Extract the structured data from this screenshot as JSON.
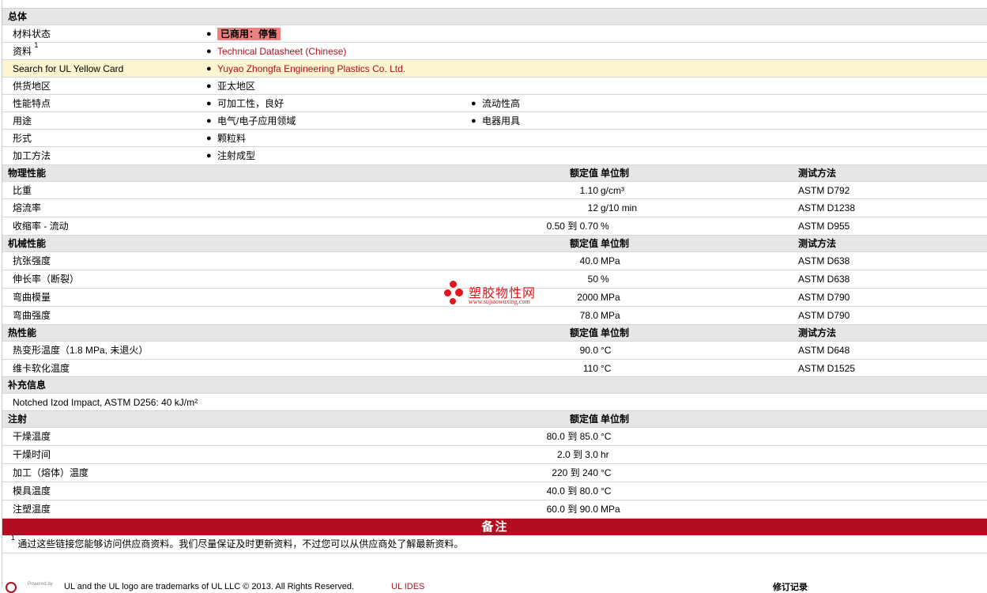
{
  "sections": {
    "general": {
      "title": "总体",
      "material_status_label": "材料状态",
      "material_status_value": "已商用：停售",
      "docs_label": "资料",
      "docs_sup": "1",
      "docs_link": "Technical Datasheet (Chinese)",
      "ul_label": "Search for UL Yellow Card",
      "ul_link": "Yuyao Zhongfa Engineering Plastics Co. Ltd.",
      "region_label": "供货地区",
      "region_value": "亚太地区",
      "features_label": "性能特点",
      "features": [
        "可加工性，良好",
        "流动性高"
      ],
      "uses_label": "用途",
      "uses": [
        "电气/电子应用领域",
        "电器用具"
      ],
      "form_label": "形式",
      "form_value": "颗粒料",
      "process_label": "加工方法",
      "process_value": "注射成型"
    },
    "physical": {
      "title": "物理性能",
      "hdr_value": "额定值",
      "hdr_unit": "单位制",
      "hdr_method": "测试方法",
      "rows": [
        {
          "label": "比重",
          "value": "1.10",
          "unit": "g/cm³",
          "method": "ASTM D792"
        },
        {
          "label": "熔流率",
          "value": "12",
          "unit": "g/10 min",
          "method": "ASTM D1238"
        },
        {
          "label": "收缩率  - 流动",
          "value": "0.50 到  0.70",
          "unit": "%",
          "method": "ASTM D955"
        }
      ]
    },
    "mechanical": {
      "title": "机械性能",
      "hdr_value": "额定值",
      "hdr_unit": "单位制",
      "hdr_method": "测试方法",
      "rows": [
        {
          "label": "抗张强度",
          "value": "40.0",
          "unit": "MPa",
          "method": "ASTM D638"
        },
        {
          "label": "伸长率（断裂）",
          "value": "50",
          "unit": "%",
          "method": "ASTM D638"
        },
        {
          "label": "弯曲模量",
          "value": "2000",
          "unit": "MPa",
          "method": "ASTM D790"
        },
        {
          "label": "弯曲强度",
          "value": "78.0",
          "unit": "MPa",
          "method": "ASTM D790"
        }
      ]
    },
    "thermal": {
      "title": "热性能",
      "hdr_value": "额定值",
      "hdr_unit": "单位制",
      "hdr_method": "测试方法",
      "rows": [
        {
          "label": "热变形温度（1.8 MPa, 未退火）",
          "value": "90.0",
          "unit": "°C",
          "method": "ASTM D648"
        },
        {
          "label": "维卡软化温度",
          "value": "110",
          "unit": "°C",
          "method": "ASTM D1525"
        }
      ]
    },
    "supplement": {
      "title": "补充信息",
      "text": "Notched Izod Impact, ASTM D256: 40 kJ/m²"
    },
    "injection": {
      "title": "注射",
      "hdr_value": "额定值",
      "hdr_unit": "单位制",
      "rows": [
        {
          "label": "干燥温度",
          "value": "80.0 到  85.0",
          "unit": "°C"
        },
        {
          "label": "干燥时间",
          "value": "2.0 到  3.0",
          "unit": "hr"
        },
        {
          "label": "加工（熔体）温度",
          "value": "220 到  240",
          "unit": "°C"
        },
        {
          "label": "模具温度",
          "value": "40.0 到  80.0",
          "unit": "°C"
        },
        {
          "label": "注塑温度",
          "value": "60.0 到  90.0",
          "unit": "MPa"
        }
      ]
    }
  },
  "notes": {
    "title": "备注",
    "sup": "1",
    "text": "通过这些链接您能够访问供应商资料。我们尽量保证及时更新资料，不过您可以从供应商处了解最新资料。"
  },
  "footer": {
    "powered": "Powered by",
    "trademark": "UL and the UL logo are trademarks of UL LLC © 2013. All Rights Reserved.",
    "ides": "UL IDES",
    "revision": "修订记录"
  },
  "watermark": {
    "title": "塑胶物性网",
    "url": "www.sujiaowuxing.com"
  },
  "colors": {
    "accent": "#b20d21",
    "highlight_row": "#fcf5cf",
    "section_bg": "#e6e6e6",
    "status_badge": "#f08080"
  }
}
